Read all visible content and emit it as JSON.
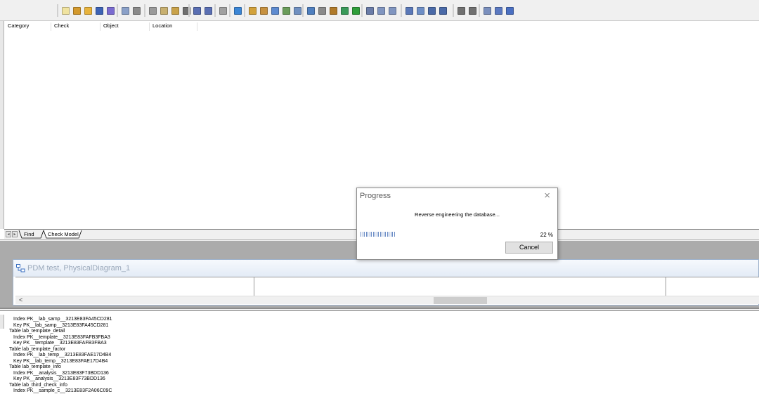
{
  "toolbar": {
    "groups": [
      {
        "icons": [
          {
            "name": "new-file-icon",
            "color": "#f0e3a0"
          },
          {
            "name": "open-model-icon",
            "color": "#d49a2e"
          },
          {
            "name": "open-folder-icon",
            "color": "#e8b33c"
          },
          {
            "name": "save-icon",
            "color": "#3d63b5"
          },
          {
            "name": "save-all-icon",
            "color": "#7a6bd0"
          }
        ]
      },
      {
        "icons": [
          {
            "name": "print-preview-icon",
            "color": "#8aa0c8"
          },
          {
            "name": "print-icon",
            "color": "#8a8a8a"
          }
        ]
      },
      {
        "icons": [
          {
            "name": "cut-icon",
            "color": "#9a9a9a"
          },
          {
            "name": "copy-icon",
            "color": "#c8b070"
          },
          {
            "name": "paste-icon",
            "color": "#c9a24a"
          },
          {
            "name": "delete-icon",
            "color": "#6f6f6f"
          }
        ]
      },
      {
        "icons": [
          {
            "name": "undo-icon",
            "color": "#5a6fb3"
          },
          {
            "name": "redo-icon",
            "color": "#5a6fb3"
          }
        ]
      },
      {
        "icons": [
          {
            "name": "properties-icon",
            "color": "#a0a0a0"
          }
        ]
      },
      {
        "icons": [
          {
            "name": "model-icon",
            "color": "#3b86d6"
          }
        ]
      },
      {
        "icons": [
          {
            "name": "table-icon",
            "color": "#d2a13a"
          },
          {
            "name": "view-icon",
            "color": "#c7913f"
          },
          {
            "name": "reference-icon",
            "color": "#5e8bd0"
          },
          {
            "name": "procedure-icon",
            "color": "#6a9c5a"
          },
          {
            "name": "package-icon",
            "color": "#7090c0"
          }
        ]
      },
      {
        "icons": [
          {
            "name": "database-icon",
            "color": "#4f7fbf"
          },
          {
            "name": "grid-icon",
            "color": "#8a8a8a"
          },
          {
            "name": "pen-icon",
            "color": "#b07a2a"
          },
          {
            "name": "link-icon",
            "color": "#3a9a5a"
          },
          {
            "name": "text-icon",
            "color": "#2f9e3a"
          }
        ]
      },
      {
        "icons": [
          {
            "name": "align-icon",
            "color": "#6a7ca8"
          },
          {
            "name": "back-icon",
            "color": "#8095c0"
          },
          {
            "name": "forward-icon",
            "color": "#8095c0"
          }
        ]
      },
      {
        "icons": [
          {
            "name": "layout-icon",
            "color": "#5a78b8"
          },
          {
            "name": "list-icon",
            "color": "#6d8ec6"
          },
          {
            "name": "browser-icon",
            "color": "#4a6aa8"
          },
          {
            "name": "output-icon",
            "color": "#4a6aa8"
          }
        ]
      },
      {
        "icons": [
          {
            "name": "zoom-icon",
            "color": "#707070"
          },
          {
            "name": "window-icon",
            "color": "#707070"
          }
        ]
      },
      {
        "icons": [
          {
            "name": "result-list-icon",
            "color": "#7a8fbd"
          },
          {
            "name": "tile-icon",
            "color": "#5b79c1"
          },
          {
            "name": "cascade-icon",
            "color": "#4a6fc2"
          }
        ]
      }
    ]
  },
  "check_model": {
    "columns": [
      "Category",
      "Check",
      "Object",
      "Location"
    ],
    "tabs": [
      "Find",
      "Check Model"
    ],
    "active_tab": "Check Model"
  },
  "diagram": {
    "title": "PDM test, PhysicalDiagram_1",
    "scroll_left_label": "<"
  },
  "output": {
    "lines": [
      {
        "text": "Index PK__lab_samp__3213E83FA45CD281",
        "indent": 1
      },
      {
        "text": "Key PK__lab_samp__3213E83FA45CD281",
        "indent": 1
      },
      {
        "text": "Table lab_template_detail",
        "indent": 0
      },
      {
        "text": "Index PK__template__3213E83FAFB3FBA3",
        "indent": 1
      },
      {
        "text": "Key PK__template__3213E83FAFB3FBA3",
        "indent": 1
      },
      {
        "text": "Table lab_template_factor",
        "indent": 0
      },
      {
        "text": "Index PK__lab_temp__3213E83FAE17D4B4",
        "indent": 1
      },
      {
        "text": "Key PK__lab_temp__3213E83FAE17D4B4",
        "indent": 1
      },
      {
        "text": "Table lab_template_info",
        "indent": 0
      },
      {
        "text": "Index PK__analysis__3213E83F73BDD136",
        "indent": 1
      },
      {
        "text": "Key PK__analysis__3213E83F73BDD136",
        "indent": 1
      },
      {
        "text": "Table lab_third_check_info",
        "indent": 0
      },
      {
        "text": "Index PK__sample_c__3213E83F2A06C09C",
        "indent": 1
      }
    ]
  },
  "progress_dialog": {
    "title": "Progress",
    "close_symbol": "×",
    "message": "Reverse engineering the database...",
    "percent_label": "22 %",
    "progress_fraction": 0.22,
    "cancel_label": "Cancel",
    "bar_color": "#6d8ec6"
  }
}
